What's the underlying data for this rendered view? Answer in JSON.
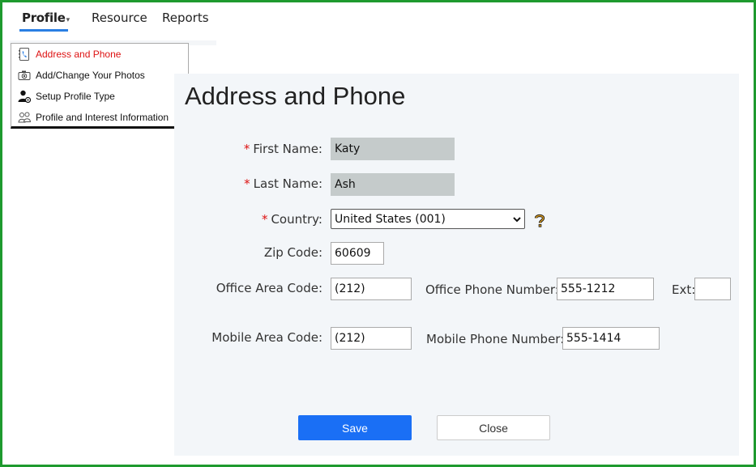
{
  "nav": {
    "tabs": [
      {
        "label": "Profile",
        "active": true
      },
      {
        "label": "Resource"
      },
      {
        "label": "Reports"
      }
    ],
    "caret": "▾"
  },
  "sidebar": {
    "items": [
      {
        "label": "Address and Phone",
        "icon": "address-book-icon",
        "active": true
      },
      {
        "label": "Add/Change Your Photos",
        "icon": "camera-icon"
      },
      {
        "label": "Setup Profile Type",
        "icon": "user-gear-icon"
      },
      {
        "label": "Profile and Interest Information",
        "icon": "people-icon"
      }
    ]
  },
  "form": {
    "title": "Address and Phone",
    "required_mark": "*",
    "first_name": {
      "label": "First Name:",
      "value": "Katy"
    },
    "last_name": {
      "label": "Last Name:",
      "value": "Ash"
    },
    "country": {
      "label": "Country:",
      "value": "United States (001)"
    },
    "zip": {
      "label": "Zip Code:",
      "value": "60609"
    },
    "office_area": {
      "label": "Office Area Code:",
      "value": "(212)"
    },
    "office_phone": {
      "label": "Office Phone Number:",
      "value": "555-1212"
    },
    "ext": {
      "label": "Ext:",
      "value": ""
    },
    "mobile_area": {
      "label": "Mobile Area Code:",
      "value": "(212)"
    },
    "mobile_phone": {
      "label": "Mobile Phone Number:",
      "value": "555-1414"
    },
    "save_label": "Save",
    "close_label": "Close"
  },
  "colors": {
    "accent": "#1a6ff5",
    "required": "#dd1111",
    "border": "#1e9a2e"
  }
}
